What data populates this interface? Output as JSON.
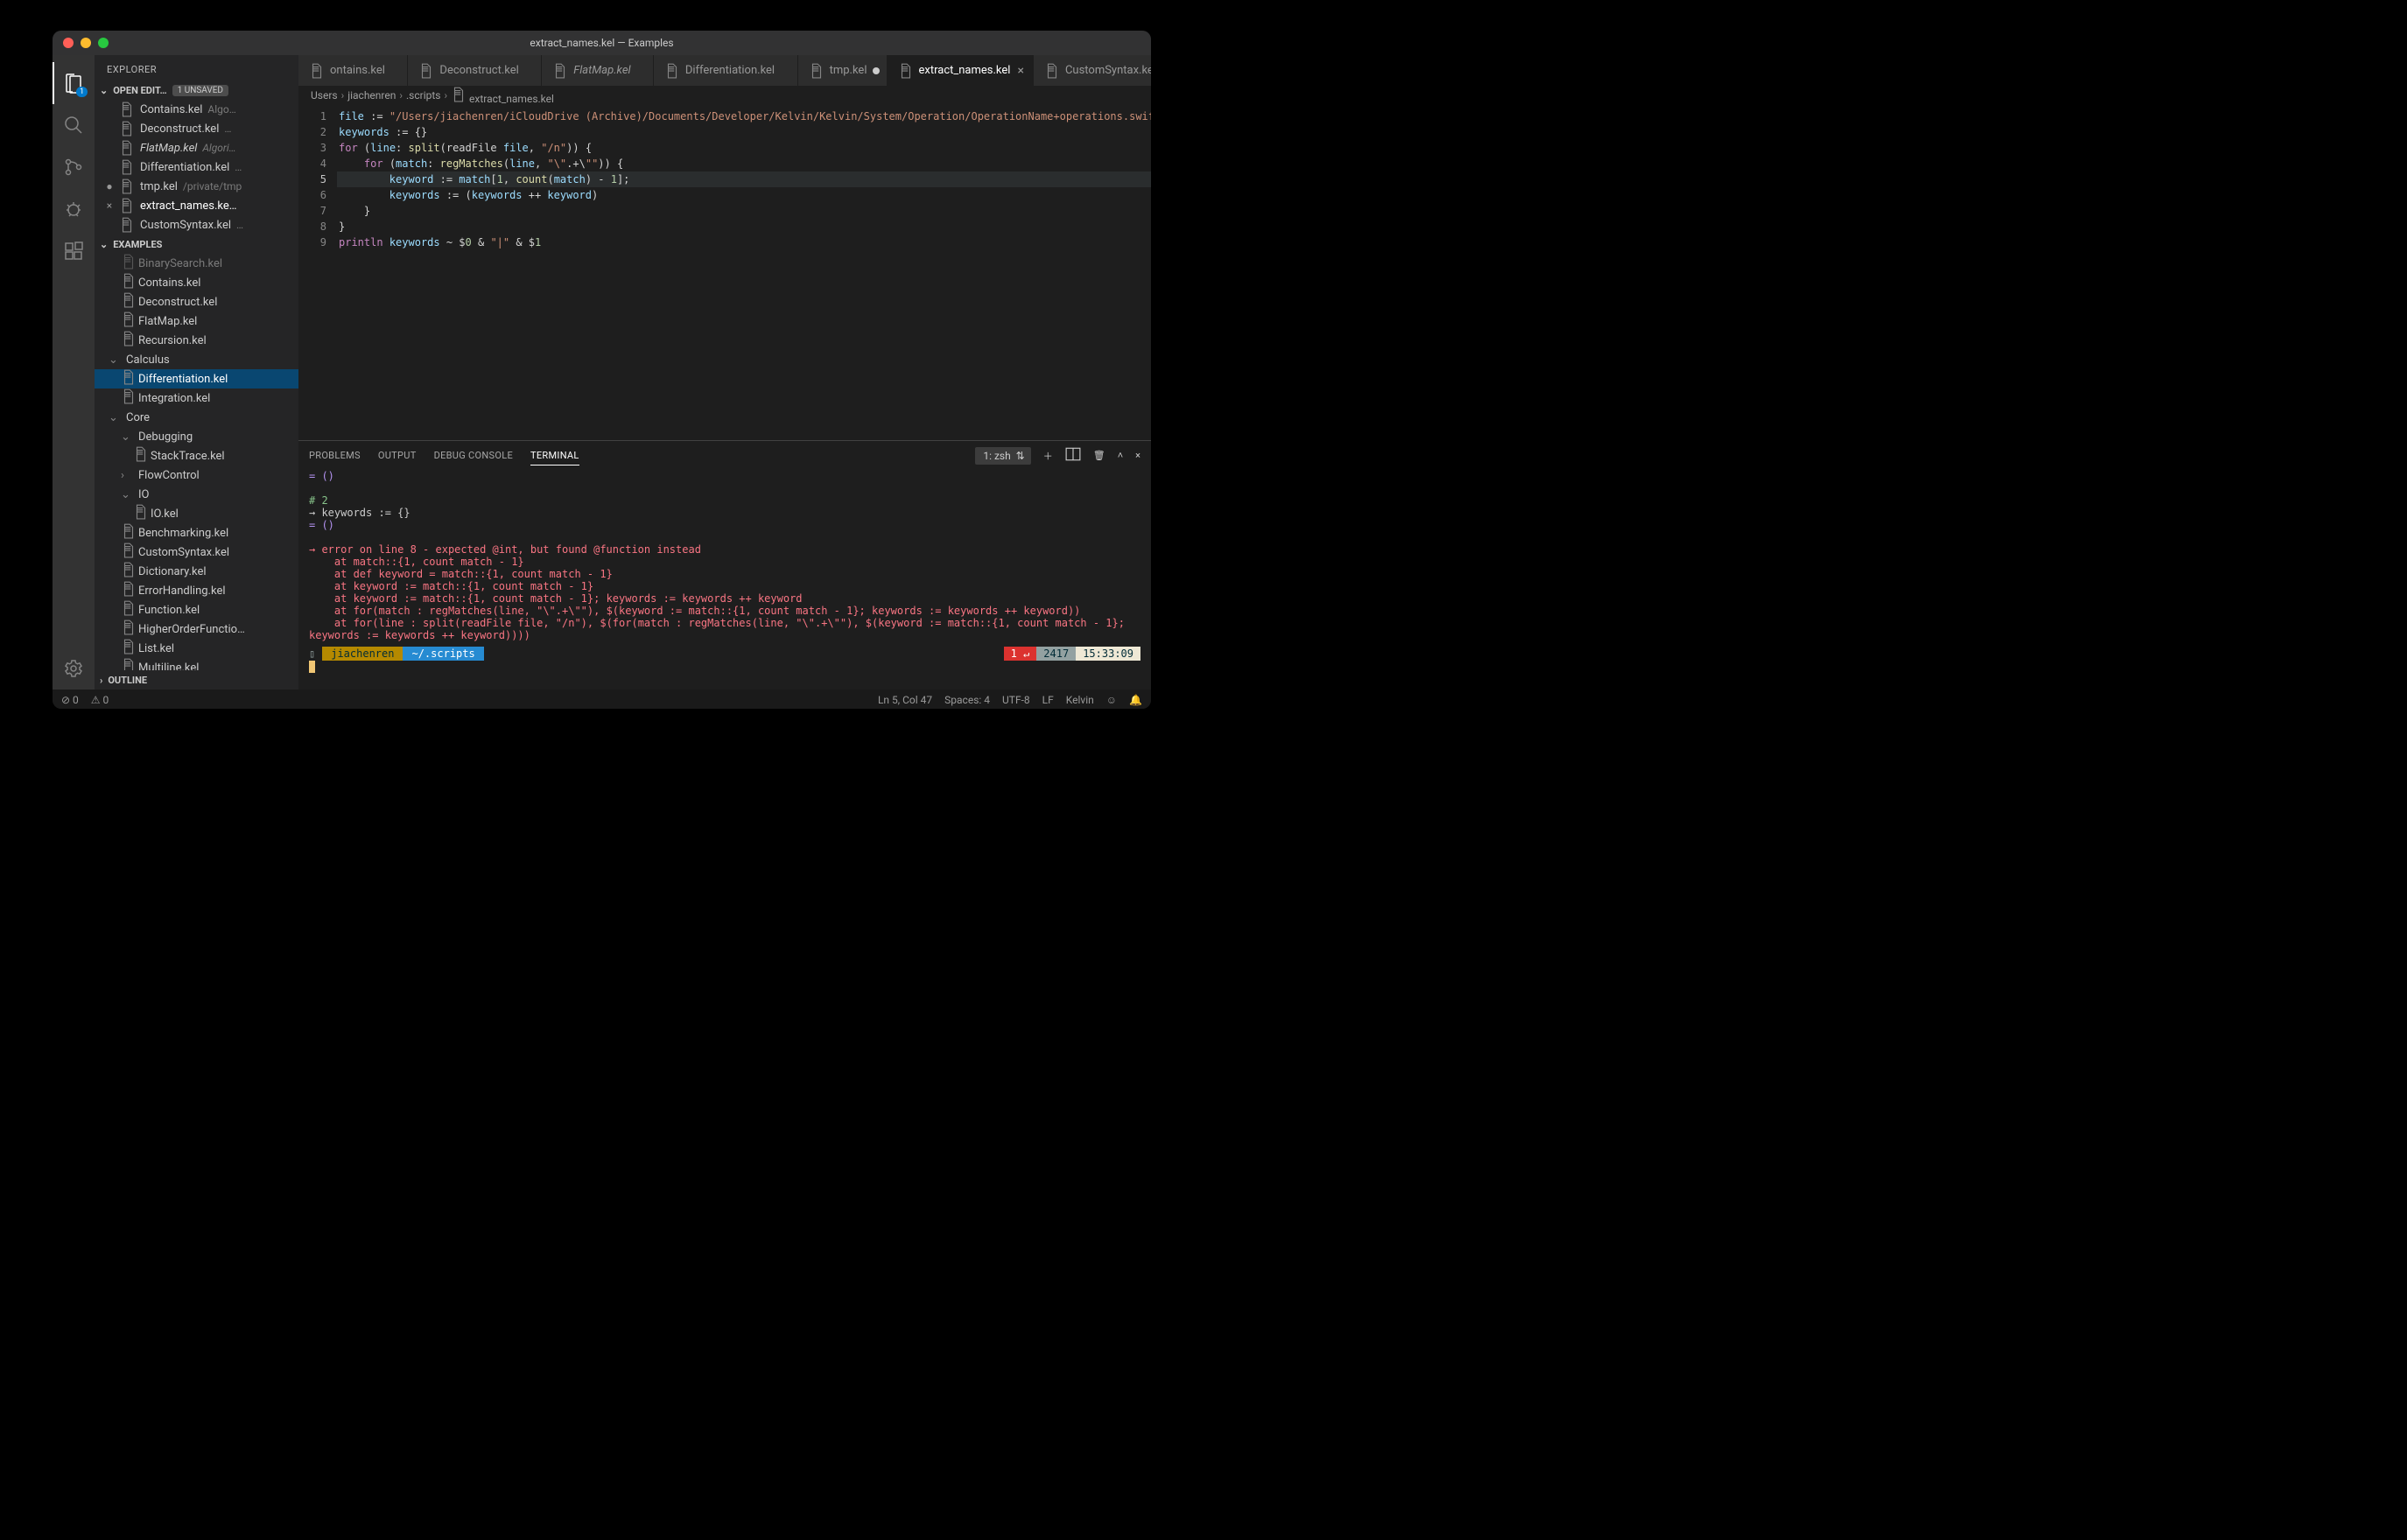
{
  "window": {
    "title": "extract_names.kel — Examples"
  },
  "activitybar": {
    "items": [
      {
        "name": "explorer",
        "badge": "1"
      },
      {
        "name": "search"
      },
      {
        "name": "scm"
      },
      {
        "name": "debug"
      },
      {
        "name": "extensions"
      }
    ],
    "bottom": [
      {
        "name": "settings"
      }
    ]
  },
  "sidebar": {
    "title": "EXPLORER",
    "openEditors": {
      "title": "OPEN EDIT…",
      "badge": "1 UNSAVED",
      "items": [
        {
          "label": "Contains.kel",
          "dim": "Algo…",
          "pre": ""
        },
        {
          "label": "Deconstruct.kel",
          "dim": "…",
          "pre": ""
        },
        {
          "label": "FlatMap.kel",
          "dim": "Algori…",
          "pre": "",
          "italic": true
        },
        {
          "label": "Differentiation.kel",
          "dim": "…",
          "pre": ""
        },
        {
          "label": "tmp.kel",
          "dim": "/private/tmp",
          "pre": "●"
        },
        {
          "label": "extract_names.ke…",
          "dim": "",
          "pre": "×",
          "active": true
        },
        {
          "label": "CustomSyntax.kel",
          "dim": "…",
          "pre": ""
        }
      ]
    },
    "examples": {
      "title": "EXAMPLES",
      "tree": [
        {
          "label": "BinarySearch.kel",
          "kind": "file",
          "level": 2,
          "dim": true
        },
        {
          "label": "Contains.kel",
          "kind": "file",
          "level": 2
        },
        {
          "label": "Deconstruct.kel",
          "kind": "file",
          "level": 2
        },
        {
          "label": "FlatMap.kel",
          "kind": "file",
          "level": 2
        },
        {
          "label": "Recursion.kel",
          "kind": "file",
          "level": 2
        },
        {
          "label": "Calculus",
          "kind": "folder",
          "level": 1,
          "open": true
        },
        {
          "label": "Differentiation.kel",
          "kind": "file",
          "level": 2,
          "selected": true
        },
        {
          "label": "Integration.kel",
          "kind": "file",
          "level": 2
        },
        {
          "label": "Core",
          "kind": "folder",
          "level": 1,
          "open": true
        },
        {
          "label": "Debugging",
          "kind": "folder",
          "level": 2,
          "open": true
        },
        {
          "label": "StackTrace.kel",
          "kind": "file",
          "level": 3
        },
        {
          "label": "FlowControl",
          "kind": "folder",
          "level": 2,
          "open": false
        },
        {
          "label": "IO",
          "kind": "folder",
          "level": 2,
          "open": true
        },
        {
          "label": "IO.kel",
          "kind": "file",
          "level": 3
        },
        {
          "label": "Benchmarking.kel",
          "kind": "file",
          "level": 2
        },
        {
          "label": "CustomSyntax.kel",
          "kind": "file",
          "level": 2
        },
        {
          "label": "Dictionary.kel",
          "kind": "file",
          "level": 2
        },
        {
          "label": "ErrorHandling.kel",
          "kind": "file",
          "level": 2
        },
        {
          "label": "Function.kel",
          "kind": "file",
          "level": 2
        },
        {
          "label": "HigherOrderFunctio…",
          "kind": "file",
          "level": 2
        },
        {
          "label": "List.kel",
          "kind": "file",
          "level": 2
        },
        {
          "label": "Multiline.kel",
          "kind": "file",
          "level": 2
        }
      ]
    },
    "outline": {
      "title": "OUTLINE"
    }
  },
  "tabs": [
    {
      "label": "ontains.kel"
    },
    {
      "label": "Deconstruct.kel"
    },
    {
      "label": "FlatMap.kel",
      "italic": true
    },
    {
      "label": "Differentiation.kel"
    },
    {
      "label": "tmp.kel",
      "modified": true
    },
    {
      "label": "extract_names.kel",
      "active": true
    },
    {
      "label": "CustomSyntax.kel"
    }
  ],
  "breadcrumbs": [
    "Users",
    "jiachenren",
    ".scripts",
    "extract_names.kel"
  ],
  "editor": {
    "lines": [
      "file := \"/Users/jiachenren/iCloudDrive (Archive)/Documents/Developer/Kelvin/Kelvin/System/Operation/OperationName+operations.swift\"",
      "keywords := {}",
      "for (line: split(readFile file, \"/n\")) {",
      "    for (match: regMatches(line, \"\\\".+\\\"\")) {",
      "        keyword := match[1, count(match) - 1];",
      "        keywords := (keywords ++ keyword)",
      "    }",
      "}",
      "println keywords ~ $0 & \"|\" & $1"
    ],
    "highlight_line": 5
  },
  "panel": {
    "tabs": [
      "PROBLEMS",
      "OUTPUT",
      "DEBUG CONSOLE",
      "TERMINAL"
    ],
    "active": "TERMINAL",
    "terminal_select": "1: zsh",
    "output": [
      {
        "cls": "eq",
        "t": "= ()"
      },
      {
        "cls": "",
        "t": ""
      },
      {
        "cls": "cmt",
        "t": "# 2"
      },
      {
        "cls": "",
        "t": "→ keywords := {}"
      },
      {
        "cls": "eq",
        "t": "= ()"
      },
      {
        "cls": "",
        "t": ""
      },
      {
        "cls": "err",
        "t": "→ error on line 8 - expected @int, but found @function instead"
      },
      {
        "cls": "err",
        "t": "    at match::{1, count match - 1}"
      },
      {
        "cls": "err",
        "t": "    at def keyword = match::{1, count match - 1}"
      },
      {
        "cls": "err",
        "t": "    at keyword := match::{1, count match - 1}"
      },
      {
        "cls": "err",
        "t": "    at keyword := match::{1, count match - 1}; keywords := keywords ++ keyword"
      },
      {
        "cls": "err",
        "t": "    at for(match : regMatches(line, \"\\\".+\\\"\"), $(keyword := match::{1, count match - 1}; keywords := keywords ++ keyword))"
      },
      {
        "cls": "err",
        "t": "    at for(line : split(readFile file, \"/n\"), $(for(match : regMatches(line, \"\\\".+\\\"\"), $(keyword := match::{1, count match - 1}; keywords := keywords ++ keyword))))"
      }
    ],
    "prompt": {
      "user": "jiachenren",
      "path": "~/.scripts",
      "err": "1 ↵",
      "count": "2417",
      "time": "15:33:09"
    }
  },
  "statusbar": {
    "left": [
      "⊘ 0",
      "⚠ 0"
    ],
    "right": [
      "Ln 5, Col 47",
      "Spaces: 4",
      "UTF-8",
      "LF",
      "Kelvin"
    ]
  }
}
